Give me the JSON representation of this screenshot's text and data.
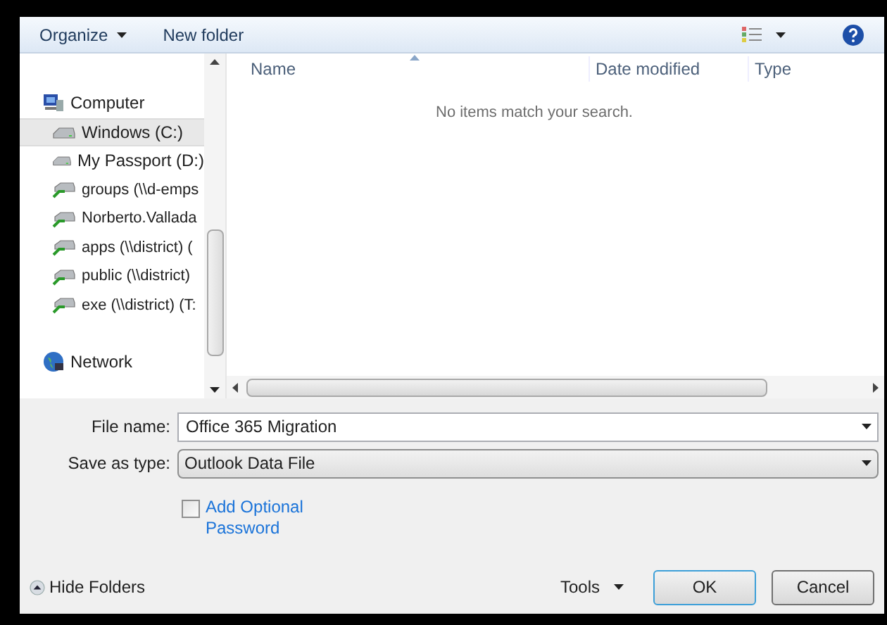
{
  "toolbar": {
    "organize": "Organize",
    "new_folder": "New folder"
  },
  "nav_items": [
    {
      "kind": "computer",
      "label": "Computer",
      "selected": false
    },
    {
      "kind": "drive",
      "label": "Windows (C:)",
      "selected": true
    },
    {
      "kind": "drive",
      "label": "My Passport (D:)",
      "selected": false
    },
    {
      "kind": "share",
      "label": "groups (\\\\d-emps",
      "selected": false
    },
    {
      "kind": "share",
      "label": "Norberto.Vallada",
      "selected": false
    },
    {
      "kind": "share",
      "label": "apps (\\\\district) (",
      "selected": false
    },
    {
      "kind": "share",
      "label": "public (\\\\district)",
      "selected": false
    },
    {
      "kind": "share",
      "label": "exe (\\\\district) (T:",
      "selected": false
    },
    {
      "kind": "network",
      "label": "Network",
      "selected": false
    }
  ],
  "columns": [
    "Name",
    "Date modified",
    "Type"
  ],
  "empty_message": "No items match your search.",
  "file_name": {
    "label": "File name:",
    "value": "Office 365 Migration"
  },
  "save_as_type": {
    "label": "Save as type:",
    "value": "Outlook Data File"
  },
  "password_option": {
    "label": "Add Optional Password",
    "checked": false
  },
  "hide_folders": "Hide Folders",
  "tools": "Tools",
  "buttons": [
    "OK",
    "Cancel"
  ]
}
